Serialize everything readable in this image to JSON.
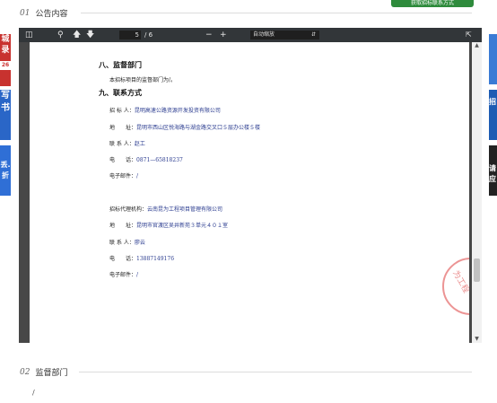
{
  "top_button": "获取招标联系方式",
  "section1": {
    "num": "01",
    "title": "公告内容"
  },
  "section2": {
    "num": "02",
    "title": "监督部门",
    "content": "/"
  },
  "side_ads": {
    "left": [
      "城",
      "录",
      "26",
      "写",
      "书",
      "丢.",
      "折"
    ],
    "right": [
      "招",
      "请",
      "应"
    ]
  },
  "toolbar": {
    "current_page": "5",
    "total_pages": "/ 6",
    "zoom": "自动缩放"
  },
  "doc": {
    "h8": "八、监督部门",
    "h8_text": "本招标项目的监督部门为/。",
    "h9": "九、联系方式",
    "contact1": [
      {
        "label": "招 标 人：",
        "value": "昆明高速公路资源开发投资有限公司"
      },
      {
        "label": "地　　址：",
        "value": "昆明市西山区悦海路与湖金路交叉口５层办公楼５楼"
      },
      {
        "label": "联 系 人：",
        "value": "赵工"
      },
      {
        "label": "电　　话：",
        "value": "0871—65818237"
      },
      {
        "label": "电子邮件：",
        "value": "/"
      }
    ],
    "contact2": [
      {
        "label": "招标代理机构：",
        "value": "云南昆为工程项目管理有限公司"
      },
      {
        "label": "地　　址：",
        "value": "昆明市官渡区吴井新苑３单元４０１室"
      },
      {
        "label": "联 系 人：",
        "value": "廖云"
      },
      {
        "label": "电　　话：",
        "value": "13887149176"
      },
      {
        "label": "电子邮件：",
        "value": "/"
      }
    ],
    "stamp_text": "为工程"
  }
}
